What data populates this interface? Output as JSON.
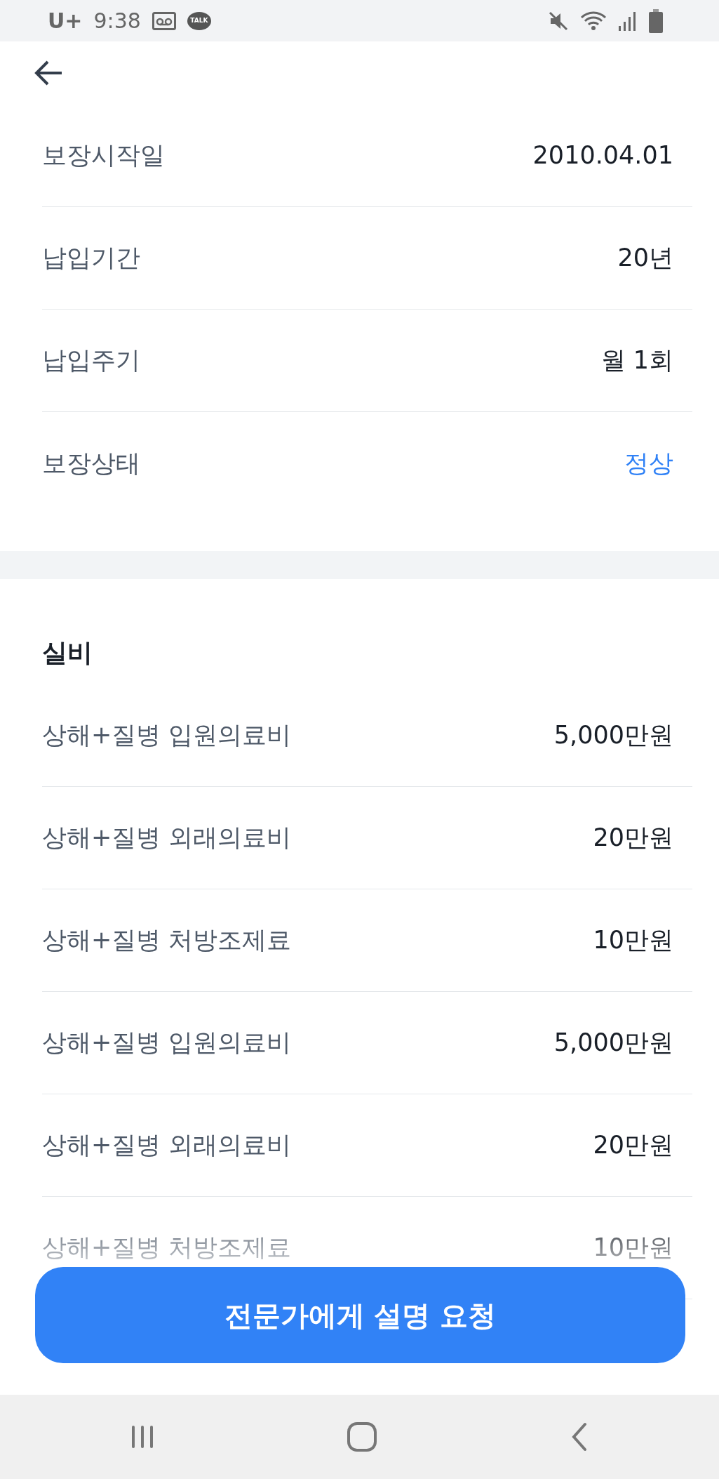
{
  "status_bar": {
    "carrier": "U+",
    "time": "9:38",
    "talk": "TALK"
  },
  "summary": {
    "rows": [
      {
        "label": "보장시작일",
        "value": "2010.04.01",
        "kind": "text"
      },
      {
        "label": "납입기간",
        "value": "20년",
        "kind": "text"
      },
      {
        "label": "납입주기",
        "value": "월 1회",
        "kind": "text"
      },
      {
        "label": "보장상태",
        "value": "정상",
        "kind": "status"
      }
    ]
  },
  "coverage": {
    "title": "실비",
    "rows": [
      {
        "label": "상해+질병 입원의료비",
        "value": "5,000만원"
      },
      {
        "label": "상해+질병 외래의료비",
        "value": "20만원"
      },
      {
        "label": "상해+질병 처방조제료",
        "value": "10만원"
      },
      {
        "label": "상해+질병 입원의료비",
        "value": "5,000만원"
      },
      {
        "label": "상해+질병 외래의료비",
        "value": "20만원"
      },
      {
        "label": "상해+질병 처방조제료",
        "value": "10만원"
      }
    ]
  },
  "button": {
    "label": "전문가에게 설명 요청"
  }
}
